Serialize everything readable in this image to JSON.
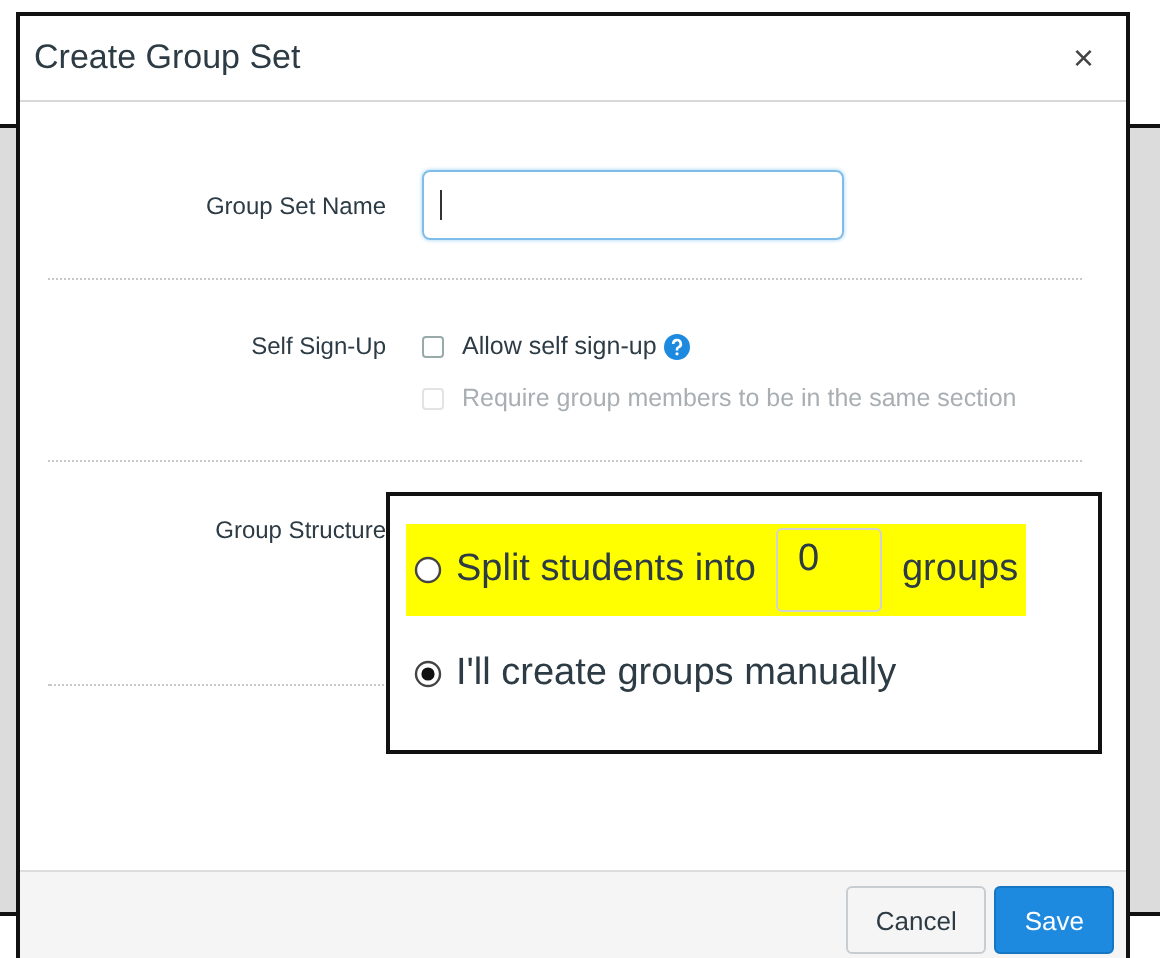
{
  "dialog": {
    "title": "Create Group Set",
    "close": "×"
  },
  "group_set_name": {
    "label": "Group Set Name",
    "focused": true
  },
  "self_sign_up": {
    "label": "Self Sign-Up",
    "options": [
      {
        "label": "Allow self sign-up",
        "checked": false,
        "disabled": false,
        "help": true
      },
      {
        "label": "Require group members to be in the same section",
        "checked": false,
        "disabled": true,
        "help": false
      }
    ]
  },
  "group_structure": {
    "label": "Group Structure",
    "options": [
      {
        "kind": "split",
        "before": "Split students into",
        "count": "0",
        "after": "groups",
        "selected": false,
        "highlighted": true
      },
      {
        "kind": "manual",
        "label": "I'll create groups manually",
        "selected": true
      }
    ]
  },
  "buttons": [
    {
      "label": "Cancel",
      "kind": "secondary"
    },
    {
      "label": "Save",
      "kind": "primary"
    }
  ]
}
